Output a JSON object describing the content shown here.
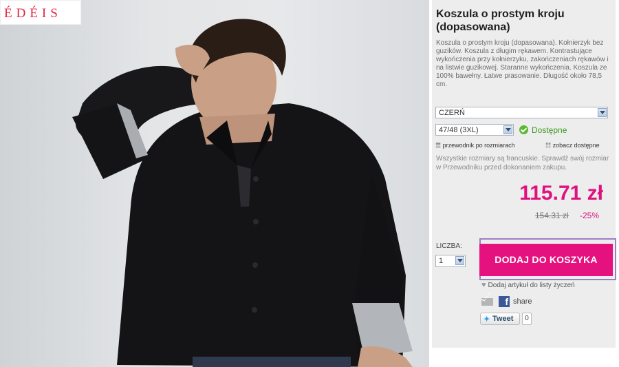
{
  "brand": {
    "logo_text": "ÉDÉIS"
  },
  "product": {
    "title": "Koszula o prostym kroju (dopasowana)",
    "description": "Koszula o prostym kroju (dopasowana). Kołnierzyk bez guzików. Koszula z długim rękawem. Kontrastujące wykończenia przy kołnierzyku, zakończeniach rękawów i na listwie guzikowej. Staranne wykończenia. Koszula ze 100% bawełny. Łatwe prasowanie. Długość około 78,5 cm.",
    "color_select": "CZERŃ",
    "size_select": "47/48 (3XL)",
    "availability": "Dostępne",
    "size_guide_link": "przewodnik po rozmiarach",
    "see_available_link": "zobacz dostępne",
    "size_note": "Wszystkie rozmiary są francuskie. Sprawdź swój rozmiar w Przewodniku przed dokonaniem zakupu.",
    "price": "115.71 zł",
    "old_price": "154.31 zł",
    "discount": "-25%",
    "qty_label": "LICZBA:",
    "qty_value": "1",
    "add_to_cart": "DODAJ DO KOSZYKA",
    "wishlist_link": "Dodaj artykuł do listy życzeń",
    "share_label": "share",
    "tweet_label": "Tweet",
    "tweet_count": "0"
  },
  "colors": {
    "accent": "#e5117e",
    "price": "#e0117f",
    "available": "#3c9a1e",
    "logo": "#e2263e",
    "focus_border": "#9b7fc0"
  },
  "icons": [
    "heart-icon",
    "mail-icon",
    "facebook-icon",
    "twitter-bird-icon",
    "checkmark-icon",
    "ruler-icon",
    "grid-icon",
    "dropdown-arrow-icon"
  ]
}
